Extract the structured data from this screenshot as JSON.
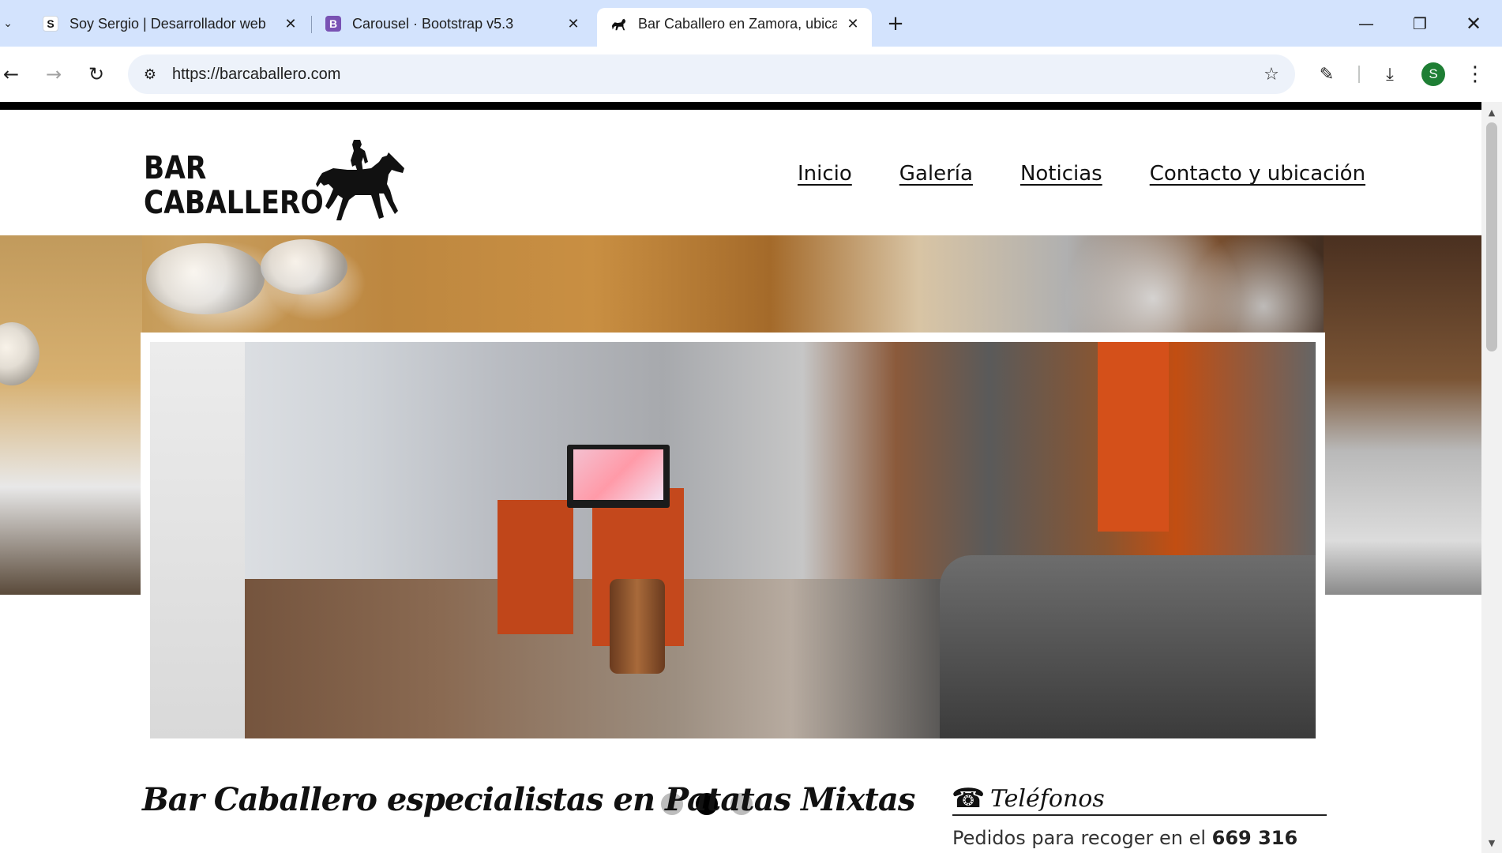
{
  "browser": {
    "tabs": [
      {
        "title": "Soy Sergio | Desarrollador web",
        "favicon": "S"
      },
      {
        "title": "Carousel · Bootstrap v5.3",
        "favicon": "B"
      },
      {
        "title": "Bar Caballero en Zamora, ubicac",
        "favicon": "horse"
      }
    ],
    "url": "https://barcaballero.com",
    "profile_initial": "S"
  },
  "site": {
    "logo": {
      "line1": "BAR",
      "line2": "CABALLERO"
    },
    "nav": [
      "Inicio",
      "Galería",
      "Noticias",
      "Contacto y ubicación"
    ]
  },
  "carousel": {
    "slides": 3,
    "active_index": 1
  },
  "content": {
    "title": "Bar Caballero especialistas en Patatas Mixtas",
    "phones_title": "Teléfonos",
    "pickup_prefix": "Pedidos para recoger en el ",
    "pickup_number": "669 316"
  },
  "colors": {
    "tabstrip": "#d3e3fd",
    "omnibox": "#edf2fa",
    "profile": "#1e7e34",
    "bootstrap_favicon": "#7952b3",
    "site_text": "#111111"
  }
}
